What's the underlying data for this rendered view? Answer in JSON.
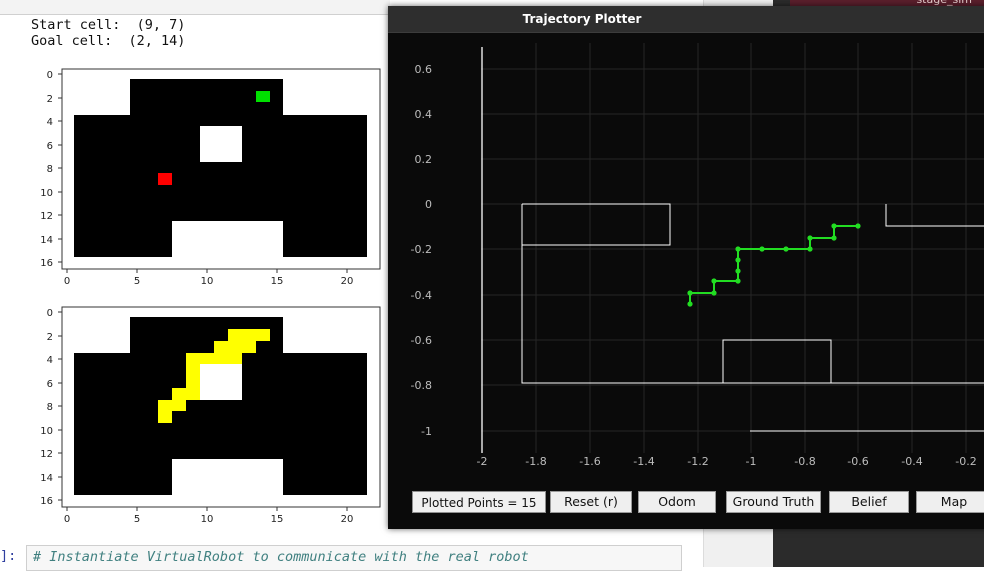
{
  "notebook": {
    "start_line": "Start cell:  (9, 7)",
    "goal_line": "Goal cell:  (2, 14)",
    "prompt": "]:",
    "code_comment": "# Instantiate VirtualRobot to communicate with the real robot"
  },
  "right_pane": {
    "tab_text": "stage_sim"
  },
  "grid_plot_1": {
    "y_ticks": [
      "0",
      "2",
      "4",
      "6",
      "8",
      "10",
      "12",
      "14",
      "16"
    ],
    "x_ticks": [
      "0",
      "5",
      "10",
      "15",
      "20"
    ],
    "start_cell": {
      "row": 9,
      "col": 7,
      "color": "#ff0000"
    },
    "goal_cell": {
      "row": 2,
      "col": 14,
      "color": "#00e000"
    }
  },
  "grid_plot_2": {
    "y_ticks": [
      "0",
      "2",
      "4",
      "6",
      "8",
      "10",
      "12",
      "14",
      "16"
    ],
    "x_ticks": [
      "0",
      "5",
      "10",
      "15",
      "20"
    ],
    "path_color": "#ffff00"
  },
  "plotter": {
    "title": "Trajectory Plotter",
    "y_ticks": [
      "0.6",
      "0.4",
      "0.2",
      "0",
      "-0.2",
      "-0.4",
      "-0.6",
      "-0.8",
      "-1"
    ],
    "x_ticks": [
      "-2",
      "-1.8",
      "-1.6",
      "-1.4",
      "-1.2",
      "-1",
      "-0.8",
      "-0.6",
      "-0.4",
      "-0.2"
    ],
    "trajectory_color": "#22dd22",
    "buttons": {
      "points_label": "Plotted Points = 15",
      "reset": "Reset (r)",
      "odom": "Odom",
      "ground_truth": "Ground Truth",
      "belief": "Belief",
      "map": "Map"
    }
  }
}
